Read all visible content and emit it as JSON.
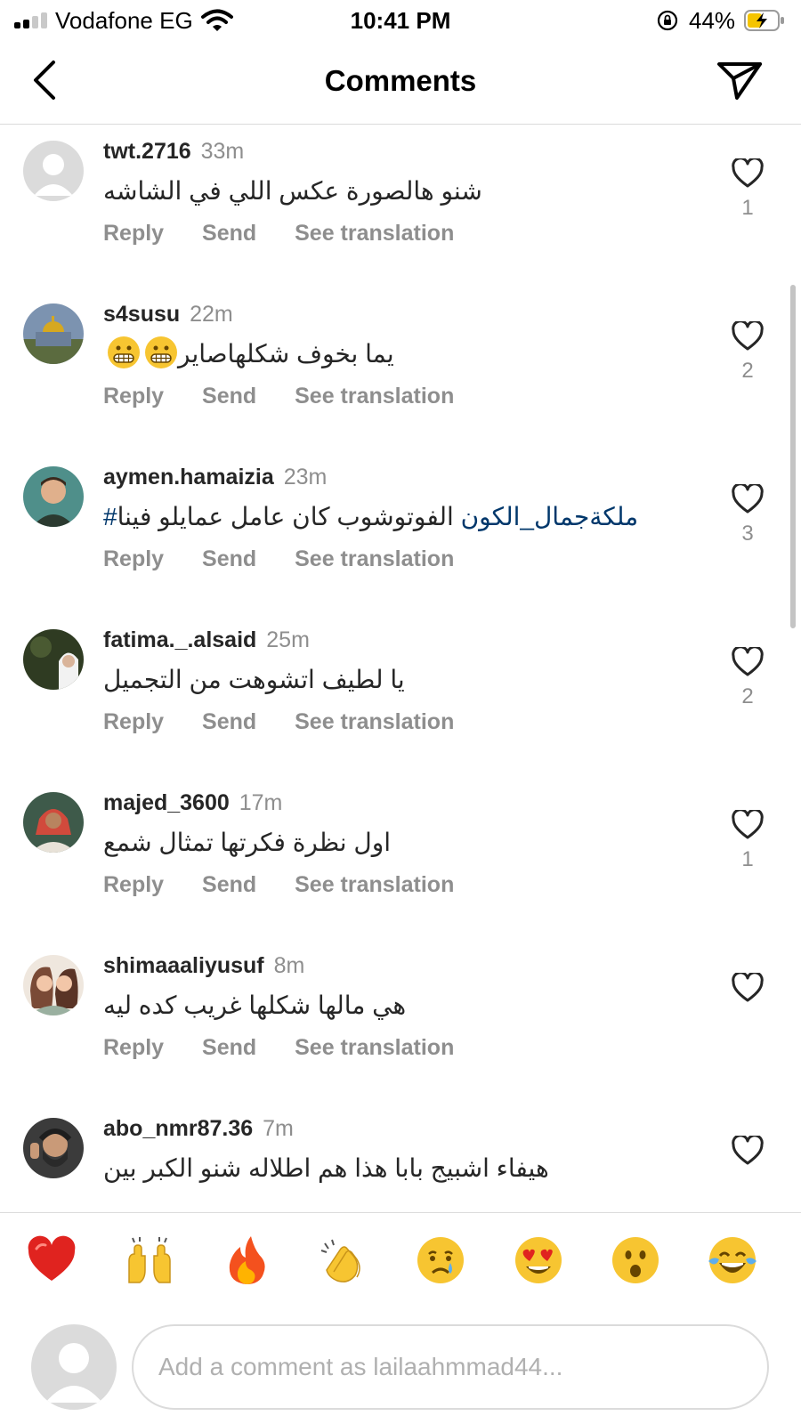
{
  "status_bar": {
    "carrier": "Vodafone EG",
    "time": "10:41 PM",
    "battery_percent": "44%",
    "signal_bars_active": 2,
    "signal_bars_total": 4,
    "battery_level": 0.44,
    "charging": true,
    "icons": [
      "signal-icon",
      "wifi-icon",
      "orientation-lock-icon",
      "battery-charging-icon"
    ]
  },
  "header": {
    "title": "Comments",
    "back_icon": "chevron-left-icon",
    "share_icon": "paper-plane-icon"
  },
  "comments": [
    {
      "username": "twt.2716",
      "time": "33m",
      "text": "شنو هالصورة عكس اللي في الشاشه",
      "hashtag": "",
      "emoji_count": 0,
      "likes": "1",
      "avatar": "default-avatar"
    },
    {
      "username": "s4susu",
      "time": "22m",
      "text": "يما بخوف شكلهاصاير",
      "hashtag": "",
      "emoji_count": 2,
      "likes": "2",
      "avatar": "dome-photo-avatar"
    },
    {
      "username": "aymen.hamaizia",
      "time": "23m",
      "text": "الفوتوشوب كان عامل عمايلو فينا ",
      "hashtag": "#ملكةجمال_الكون",
      "emoji_count": 0,
      "likes": "3",
      "avatar": "child-photo-avatar"
    },
    {
      "username": "fatima._.alsaid",
      "time": "25m",
      "text": "يا لطيف اتشوهت من التجميل",
      "hashtag": "",
      "emoji_count": 0,
      "likes": "2",
      "avatar": "woman-photo-avatar"
    },
    {
      "username": "majed_3600",
      "time": "17m",
      "text": "اول نظرة فكرتها تمثال شمع",
      "hashtag": "",
      "emoji_count": 0,
      "likes": "1",
      "avatar": "man-photo-avatar"
    },
    {
      "username": "shimaaaliyusuf",
      "time": "8m",
      "text": "هي مالها شكلها غريب كده ليه",
      "hashtag": "",
      "emoji_count": 0,
      "likes": "",
      "avatar": "cartoon-avatar"
    },
    {
      "username": "abo_nmr87.36",
      "time": "7m",
      "text": "هيفاء  اشبيج  بابا  هذا  هم اطلاله  شنو  الكبر  بين",
      "hashtag": "",
      "emoji_count": 0,
      "likes": "",
      "avatar": "bearded-man-avatar"
    }
  ],
  "comment_actions": {
    "reply": "Reply",
    "send": "Send",
    "see_translation": "See translation"
  },
  "emoji_bar": [
    "red-heart-emoji",
    "raising-hands-emoji",
    "fire-emoji",
    "clapping-hands-emoji",
    "crying-face-emoji",
    "heart-eyes-emoji",
    "surprised-face-emoji",
    "tears-of-joy-emoji"
  ],
  "compose": {
    "placeholder": "Add a comment as lailaahmmad44..."
  }
}
